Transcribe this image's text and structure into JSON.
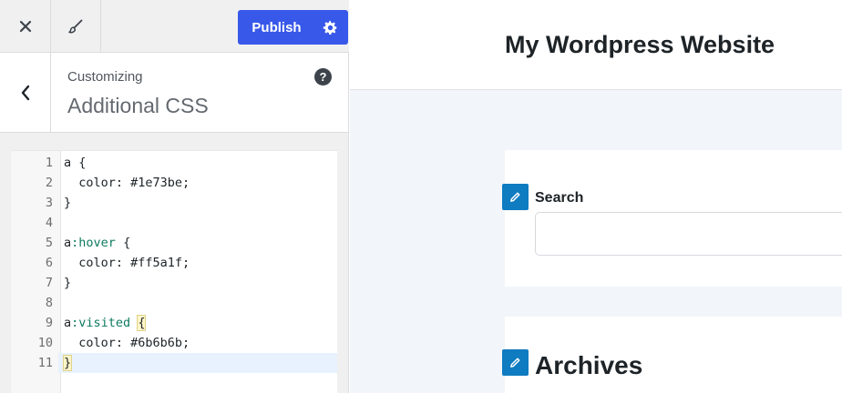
{
  "topbar": {
    "close_icon": "close-icon",
    "brush_icon": "brush-icon",
    "publish_label": "Publish",
    "settings_icon": "gear-icon",
    "accent_color": "#3858e9"
  },
  "section": {
    "crumb": "Customizing",
    "title": "Additional CSS",
    "help_label": "?"
  },
  "editor": {
    "lines": [
      {
        "n": "1",
        "text": "a {"
      },
      {
        "n": "2",
        "text": "  color: #1e73be;"
      },
      {
        "n": "3",
        "text": "}"
      },
      {
        "n": "4",
        "text": ""
      },
      {
        "n": "5",
        "text": "a:hover {"
      },
      {
        "n": "6",
        "text": "  color: #ff5a1f;"
      },
      {
        "n": "7",
        "text": "}"
      },
      {
        "n": "8",
        "text": ""
      },
      {
        "n": "9",
        "text": "a:visited {"
      },
      {
        "n": "10",
        "text": "  color: #6b6b6b;"
      },
      {
        "n": "11",
        "text": "}"
      }
    ],
    "active_line": "11"
  },
  "preview": {
    "site_title": "My Wordpress Website",
    "search_label": "Search",
    "archives_title": "Archives",
    "shortcut_color": "#0f7bc0"
  }
}
